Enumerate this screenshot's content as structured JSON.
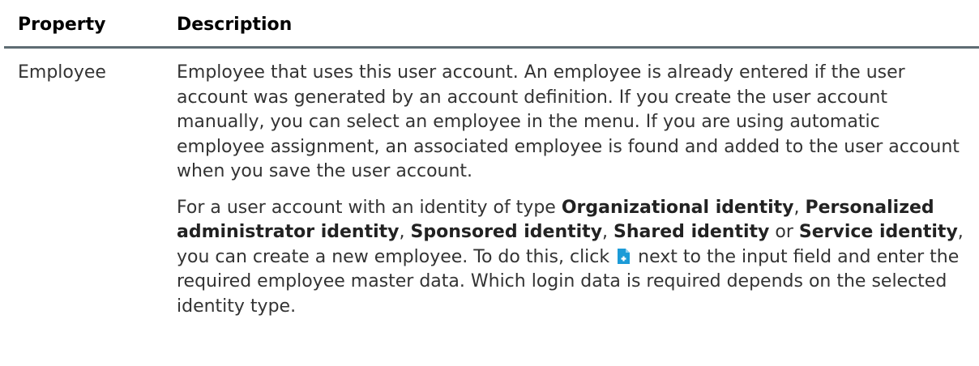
{
  "table": {
    "headers": {
      "property": "Property",
      "description": "Description"
    },
    "row": {
      "property": "Employee",
      "paragraph1": "Employee that uses this user account. An employee is already entered if the user account was generated by an account definition. If you create the user account manually, you can select an employee in the menu. If you are using automatic employee assignment, an associated employee is found and added to the user account when you save the user account.",
      "paragraph2": {
        "t1": "For a user account with an identity of type ",
        "b1": "Organizational identity",
        "t2": ", ",
        "b2": "Personalized administrator identity",
        "t3": ", ",
        "b3": "Sponsored identity",
        "t4": ", ",
        "b4": "Shared identity",
        "t5": " or ",
        "b5": "Service identity",
        "t6": ", you can create a new employee. To do this, click ",
        "icon": "new-document-plus-icon",
        "t7": " next to the input field and enter the required employee master data. Which login data is required depends on the selected identity type."
      }
    }
  },
  "colors": {
    "header_rule": "#5e6c73",
    "icon_blue": "#1c9bd7"
  }
}
